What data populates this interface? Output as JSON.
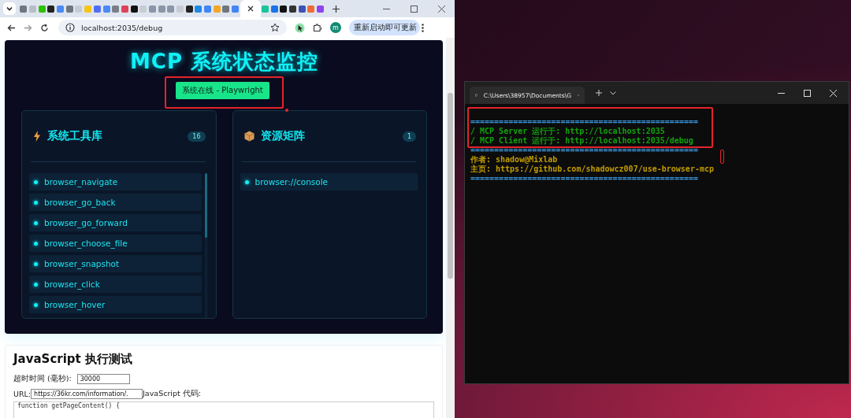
{
  "browser": {
    "tabs": [
      {
        "color": "#6e7681",
        "selected": false
      },
      {
        "color": "#b8bec8",
        "selected": false
      },
      {
        "color": "#2dc100",
        "selected": false
      },
      {
        "color": "#222222",
        "selected": false
      },
      {
        "color": "#4a8af4",
        "selected": false
      },
      {
        "color": "#6e7681",
        "selected": false
      },
      {
        "color": "#c7ccd4",
        "selected": false
      },
      {
        "color": "#f5c518",
        "selected": false
      },
      {
        "color": "#4f6ef7",
        "selected": false
      },
      {
        "color": "#4a8af4",
        "selected": false
      },
      {
        "color": "#7a7f87",
        "selected": false
      },
      {
        "color": "#e0405a",
        "selected": false
      },
      {
        "color": "#111111",
        "selected": false
      },
      {
        "color": "#c7ccd4",
        "selected": false
      },
      {
        "color": "#8a96a8",
        "selected": false
      },
      {
        "color": "#8a96a8",
        "selected": false
      },
      {
        "color": "#8a96a8",
        "selected": false
      },
      {
        "color": "#c7ccd4",
        "selected": false
      },
      {
        "color": "#222222",
        "selected": false
      },
      {
        "color": "#1e88e5",
        "selected": false
      },
      {
        "color": "#4285f4",
        "selected": false
      },
      {
        "color": "#f5a623",
        "selected": false
      },
      {
        "color": "#6e7681",
        "selected": false
      },
      {
        "color": "#4285f4",
        "selected": false
      },
      {
        "selected": true
      },
      {
        "color": "#19c39c",
        "selected": false
      },
      {
        "color": "#1a73e8",
        "selected": false
      },
      {
        "color": "#111111",
        "selected": false
      },
      {
        "color": "#333333",
        "selected": false
      },
      {
        "color": "#3f51b5",
        "selected": false
      },
      {
        "color": "#f06a35",
        "selected": false
      },
      {
        "color": "#8e44ec",
        "selected": false
      }
    ],
    "address": "localhost:2035/debug",
    "profile_initial": "m",
    "update_button": "重新启动即可更新"
  },
  "page": {
    "title": "MCP 系统状态监控",
    "status_badge": "系统在线 - Playwright",
    "panels": [
      {
        "title": "系统工具库",
        "count": "16",
        "items": [
          "browser_navigate",
          "browser_go_back",
          "browser_go_forward",
          "browser_choose_file",
          "browser_snapshot",
          "browser_click",
          "browser_hover"
        ]
      },
      {
        "title": "资源矩阵",
        "count": "1",
        "items": [
          "browser://console"
        ]
      }
    ],
    "js_test": {
      "heading": "JavaScript 执行测试",
      "timeout_label": "超时时间 (毫秒):",
      "timeout_value": "30000",
      "url_label": "URL:",
      "url_value": "https://36kr.com/information/.",
      "code_label": "JavaScript 代码:",
      "code": "function getPageContent() {"
    }
  },
  "terminal": {
    "tab_title": "C:\\Users\\38957\\Documents\\G",
    "lines": [
      {
        "text": "================================================",
        "color": "#3a96dd"
      },
      {
        "text": "/ MCP Server 运行于: http://localhost:2035",
        "color": "#13a10e"
      },
      {
        "text": "/ MCP Client 运行于: http://localhost:2035/debug",
        "color": "#13a10e"
      },
      {
        "text": "================================================",
        "color": "#3a96dd"
      },
      {
        "text": "作者: shadow@Mixlab",
        "color": "#c19c00"
      },
      {
        "text": "主页: https://github.com/shadowcz007/use-browser-mcp",
        "color": "#c19c00"
      },
      {
        "text": "================================================",
        "color": "#3a96dd"
      }
    ]
  }
}
